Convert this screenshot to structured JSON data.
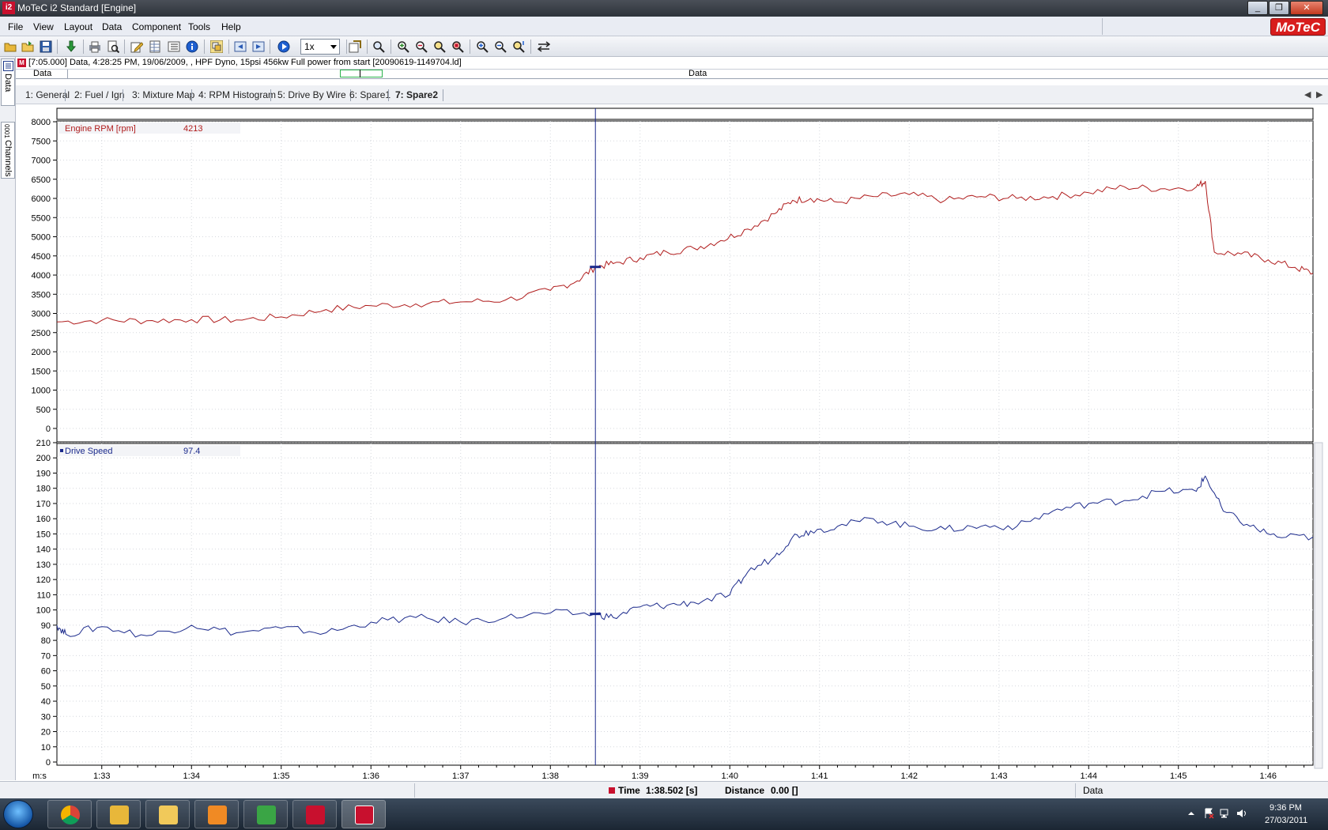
{
  "window": {
    "title": "MoTeC i2 Standard [Engine]",
    "app_icon_text": "i2",
    "buttons": [
      "_",
      "❐",
      "✕"
    ]
  },
  "menu": [
    "File",
    "View",
    "Layout",
    "Data",
    "Component",
    "Tools",
    "Help"
  ],
  "logo": "MoTeC",
  "toolbar": {
    "zoom_value": "1x",
    "icons": [
      "open-folder-icon",
      "open-icon",
      "save-icon",
      "download-icon",
      "print-icon",
      "print-preview-icon",
      "edit-icon",
      "table-icon",
      "list-icon",
      "info-icon",
      "overlay-icon",
      "back-icon",
      "forward-icon",
      "play-icon",
      "search-icon",
      "zoom-in-icon",
      "zoom-out-icon",
      "zoom-fit-icon",
      "zoom-reset-icon",
      "zoom-x-in-icon",
      "zoom-y-icon",
      "zoom-custom-icon",
      "sync-icon"
    ]
  },
  "side_tabs": {
    "data": "Data",
    "channels": "Channels",
    "channels_badge": "0001"
  },
  "infobar": {
    "badge": "M",
    "text": "[7:05.000] Data, 4:28:25 PM, 19/06/2009, , HPF Dyno, 15psi 456kw Full power from start [20090619-1149704.ld]"
  },
  "overview": {
    "left_label": "Data",
    "mid_label": "Data"
  },
  "tabs": [
    {
      "label": "1: General",
      "active": false
    },
    {
      "label": "2: Fuel / Ign",
      "active": false
    },
    {
      "label": "3: Mixture Map",
      "active": false
    },
    {
      "label": "4: RPM Histogram",
      "active": false
    },
    {
      "label": "5: Drive By Wire",
      "active": false
    },
    {
      "label": "6: Spare1",
      "active": false
    },
    {
      "label": "7: Spare2",
      "active": true
    }
  ],
  "tab_nav": [
    "◀",
    "▶"
  ],
  "chart_data": [
    {
      "type": "line",
      "series": [
        {
          "name": "Engine RPM [rpm]",
          "color": "#b01c1c"
        }
      ],
      "cursor_value": "4213",
      "ylim": [
        0,
        8000
      ],
      "yticks": [
        0,
        500,
        1000,
        1500,
        2000,
        2500,
        3000,
        3500,
        4000,
        4500,
        5000,
        5500,
        6000,
        6500,
        7000,
        7500,
        8000
      ],
      "xlim": [
        92.5,
        106.5
      ],
      "x": [
        92.5,
        93.0,
        93.5,
        94.0,
        94.5,
        95.0,
        95.5,
        96.0,
        96.5,
        97.0,
        97.5,
        98.0,
        98.3,
        98.5,
        98.7,
        99.0,
        99.3,
        99.6,
        99.9,
        100.2,
        100.5,
        100.7,
        100.9,
        101.2,
        101.6,
        102.0,
        102.4,
        102.8,
        103.2,
        103.6,
        104.0,
        104.4,
        104.8,
        105.2,
        105.3,
        105.4,
        105.7,
        106.0,
        106.3,
        106.5
      ],
      "values": [
        2780,
        2820,
        2810,
        2840,
        2830,
        2910,
        3100,
        3200,
        3250,
        3300,
        3350,
        3600,
        3850,
        4213,
        4300,
        4450,
        4600,
        4700,
        4900,
        5200,
        5600,
        5950,
        6000,
        5900,
        6050,
        6100,
        5950,
        6050,
        6000,
        6050,
        6150,
        6300,
        6250,
        6300,
        6450,
        4600,
        4550,
        4400,
        4200,
        4050
      ]
    },
    {
      "type": "line",
      "series": [
        {
          "name": "Drive Speed",
          "color": "#1b2a8c"
        }
      ],
      "cursor_value": "97.4",
      "ylim": [
        0,
        210
      ],
      "yticks": [
        0,
        10,
        20,
        30,
        40,
        50,
        60,
        70,
        80,
        90,
        100,
        110,
        120,
        130,
        140,
        150,
        160,
        170,
        180,
        190,
        200,
        210
      ],
      "xlim": [
        92.5,
        106.5
      ],
      "x": [
        92.5,
        92.6,
        93.0,
        93.5,
        94.0,
        94.5,
        95.0,
        95.5,
        96.0,
        96.5,
        97.0,
        97.5,
        98.0,
        98.5,
        98.7,
        99.0,
        99.3,
        99.6,
        100.0,
        100.2,
        100.5,
        100.7,
        100.9,
        101.2,
        101.6,
        102.0,
        102.4,
        102.8,
        103.2,
        103.6,
        104.0,
        104.4,
        104.8,
        105.2,
        105.3,
        105.5,
        105.8,
        106.1,
        106.5
      ],
      "values": [
        90,
        84,
        89,
        83,
        90,
        85,
        88,
        85,
        92,
        95,
        92,
        95,
        98,
        97.4,
        95,
        102,
        103,
        105,
        110,
        125,
        135,
        148,
        152,
        155,
        160,
        155,
        153,
        155,
        155,
        165,
        170,
        172,
        178,
        178,
        188,
        165,
        155,
        148,
        148
      ]
    }
  ],
  "x_axis": {
    "unit_label": "m:s",
    "tick_labels": [
      "1:33",
      "1:34",
      "1:35",
      "1:36",
      "1:37",
      "1:38",
      "1:39",
      "1:40",
      "1:41",
      "1:42",
      "1:43",
      "1:44",
      "1:45",
      "1:46"
    ],
    "tick_values": [
      93,
      94,
      95,
      96,
      97,
      98,
      99,
      100,
      101,
      102,
      103,
      104,
      105,
      106
    ],
    "cursor_value": 98.502
  },
  "status": {
    "time_label": "Time",
    "time_value": "1:38.502 [s]",
    "distance_label": "Distance",
    "distance_value": "0.00 []",
    "data_label": "Data"
  },
  "taskbar": {
    "clock_time": "9:36 PM",
    "clock_date": "27/03/2011"
  }
}
